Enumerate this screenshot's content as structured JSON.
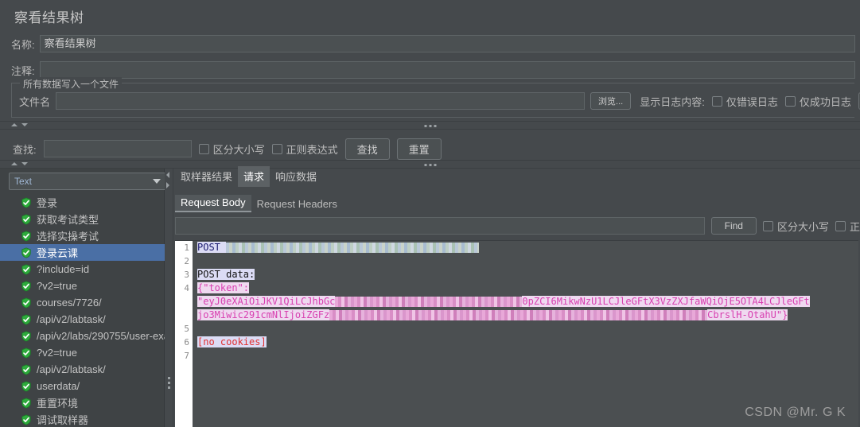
{
  "window": {
    "title": "察看结果树"
  },
  "fields": {
    "name_label": "名称:",
    "name_value": "察看结果树",
    "comment_label": "注释:",
    "comment_value": ""
  },
  "group": {
    "legend": "所有数据写入一个文件",
    "file_label": "文件名",
    "file_value": "",
    "browse_button": "浏览...",
    "log_content_label": "显示日志内容:",
    "checkbox_errors_only": "仅错误日志",
    "checkbox_success_only": "仅成功日志"
  },
  "search": {
    "label": "查找:",
    "value": "",
    "checkbox_case": "区分大小写",
    "checkbox_regex": "正则表达式",
    "find_button": "查找",
    "reset_button": "重置"
  },
  "tree": {
    "render_select": "Text",
    "items": [
      {
        "label": "登录",
        "selected": false
      },
      {
        "label": "获取考试类型",
        "selected": false
      },
      {
        "label": "选择实操考试",
        "selected": false
      },
      {
        "label": "登录云课",
        "selected": true
      },
      {
        "label": "?include=id",
        "selected": false
      },
      {
        "label": "?v2=true",
        "selected": false
      },
      {
        "label": "courses/7726/",
        "selected": false
      },
      {
        "label": "/api/v2/labtask/",
        "selected": false
      },
      {
        "label": "/api/v2/labs/290755/user-exa",
        "selected": false
      },
      {
        "label": "?v2=true",
        "selected": false
      },
      {
        "label": "/api/v2/labtask/",
        "selected": false
      },
      {
        "label": "userdata/",
        "selected": false
      },
      {
        "label": "重置环境",
        "selected": false
      },
      {
        "label": "调试取样器",
        "selected": false
      }
    ]
  },
  "main_tabs": [
    {
      "label": "取样器结果",
      "active": false
    },
    {
      "label": "请求",
      "active": true
    },
    {
      "label": "响应数据",
      "active": false
    }
  ],
  "sub_tabs": [
    {
      "label": "Request Body",
      "active": true
    },
    {
      "label": "Request Headers",
      "active": false
    }
  ],
  "find_bar": {
    "value": "",
    "find_button": "Find",
    "checkbox_case": "区分大小写",
    "checkbox_regex": "正"
  },
  "code": {
    "line_numbers": [
      "1",
      "2",
      "3",
      "4",
      "5",
      "6",
      "7"
    ],
    "line1_method": "POST ",
    "line3_text": "POST data:",
    "line4_open": "{\"token\":",
    "line4_tok_a": "\"eyJ0eXAiOiJKV1QiLCJhbGc",
    "line4_tok_a_tail": "0pZCI6MikwNzU1LCJleGFtX3VzZXJfaWQiOjE5OTA4LCJleGFt",
    "line4_tok_b": "jo3Miwic291cmNlIjoiZGFz",
    "line4_tok_b_tail": "CbrslH-OtahU\"}",
    "line6_text": "[no cookies]"
  },
  "watermark": "CSDN @Mr. G K",
  "colors": {
    "background": "#45494c",
    "panel": "#3f4345",
    "selection": "#4a6fa5",
    "shield_green": "#2eaa3c",
    "code_bg": "#4b4f51",
    "string_pink": "#d83fb0",
    "keyword_navy": "#1a1a6e",
    "error_red": "#e03030"
  }
}
